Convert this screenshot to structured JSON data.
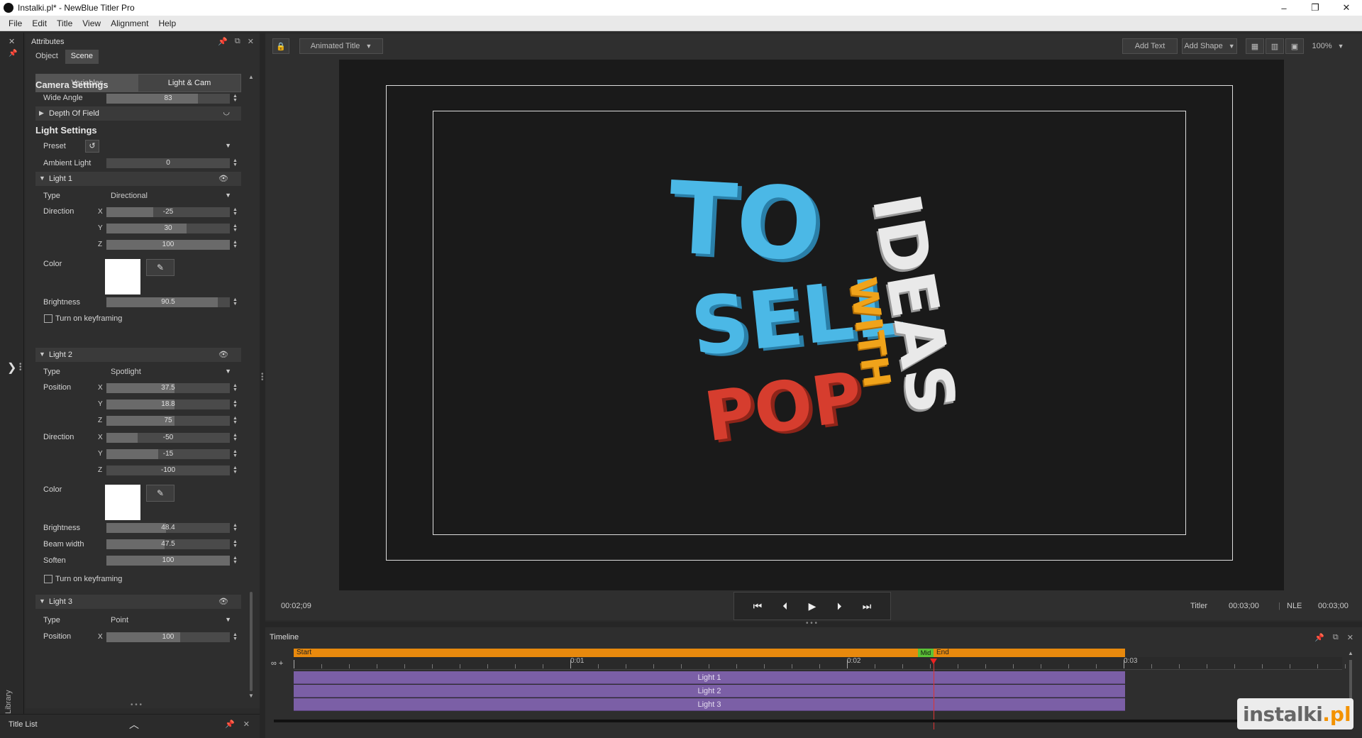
{
  "window": {
    "title": "Instalki.pl* - NewBlue Titler Pro",
    "minimize": "–",
    "maximize": "❐",
    "close": "✕"
  },
  "menu": [
    "File",
    "Edit",
    "Title",
    "View",
    "Alignment",
    "Help"
  ],
  "left_strip": {
    "library_label": "Library"
  },
  "attributes": {
    "title": "Attributes",
    "tabs": [
      {
        "label": "Object",
        "active": false
      },
      {
        "label": "Scene",
        "active": true
      }
    ],
    "subtabs": [
      {
        "label": "Variables",
        "active": false
      },
      {
        "label": "Light & Cam",
        "active": true
      }
    ],
    "camera_settings": {
      "title": "Camera Settings",
      "wide_angle": {
        "label": "Wide Angle",
        "value": "83",
        "fraction": 0.74
      },
      "depth_of_field": {
        "label": "Depth Of Field"
      }
    },
    "light_settings": {
      "title": "Light Settings",
      "preset": {
        "label": "Preset",
        "value": ""
      },
      "ambient_light": {
        "label": "Ambient Light",
        "value": "0",
        "fraction": 0.0
      }
    },
    "light1": {
      "name": "Light 1",
      "type_label": "Type",
      "type_value": "Directional",
      "direction_label": "Direction",
      "x": {
        "axis": "X",
        "value": "-25",
        "fraction": 0.38
      },
      "y": {
        "axis": "Y",
        "value": "30",
        "fraction": 0.65
      },
      "z": {
        "axis": "Z",
        "value": "100",
        "fraction": 1.0
      },
      "color_label": "Color",
      "color": "#ffffff",
      "brightness": {
        "label": "Brightness",
        "value": "90.5",
        "fraction": 0.9
      },
      "keyframing": {
        "label": "Turn on keyframing",
        "checked": false
      }
    },
    "light2": {
      "name": "Light 2",
      "type_label": "Type",
      "type_value": "Spotlight",
      "position_label": "Position",
      "px": {
        "axis": "X",
        "value": "37.5",
        "fraction": 0.55
      },
      "py": {
        "axis": "Y",
        "value": "18.8",
        "fraction": 0.55
      },
      "pz": {
        "axis": "Z",
        "value": "75",
        "fraction": 0.55
      },
      "direction_label": "Direction",
      "dx": {
        "axis": "X",
        "value": "-50",
        "fraction": 0.25
      },
      "dy": {
        "axis": "Y",
        "value": "-15",
        "fraction": 0.42
      },
      "dz": {
        "axis": "Z",
        "value": "-100",
        "fraction": 0.0
      },
      "color_label": "Color",
      "color": "#ffffff",
      "brightness": {
        "label": "Brightness",
        "value": "48.4",
        "fraction": 0.48
      },
      "beam_width": {
        "label": "Beam width",
        "value": "47.5",
        "fraction": 0.47
      },
      "soften": {
        "label": "Soften",
        "value": "100",
        "fraction": 1.0
      },
      "keyframing": {
        "label": "Turn on keyframing",
        "checked": false
      }
    },
    "light3": {
      "name": "Light 3",
      "type_label": "Type",
      "type_value": "Point",
      "position_label": "Position",
      "px": {
        "axis": "X",
        "value": "100",
        "fraction": 0.6
      }
    }
  },
  "title_list": {
    "label": "Title List"
  },
  "canvas_toolbar": {
    "title_type": "Animated Title",
    "add_text": "Add Text",
    "add_shape": "Add Shape",
    "zoom": "100%"
  },
  "artwork": {
    "words": [
      "TO",
      "SELL",
      "POP",
      "IDEAS",
      "WITH"
    ],
    "colors": {
      "blue": "#4bb8e6",
      "white": "#e9e9e9",
      "orange": "#f0a31a",
      "red": "#d63d2e"
    }
  },
  "transport": {
    "current_time": "00:02;09",
    "titler_label": "Titler",
    "titler_time": "00:03;00",
    "nle_label": "NLE",
    "nle_time": "00:03;00"
  },
  "timeline": {
    "title": "Timeline",
    "start_label": "Start",
    "mid_label": "Mid",
    "end_label": "End",
    "ticks": [
      "0:01",
      "0:02",
      "0:03"
    ],
    "tracks": [
      "Light 1",
      "Light 2",
      "Light 3"
    ],
    "colors": {
      "orange": "#e8890d",
      "track": "#7b5fa6",
      "mid": "#5bc236",
      "playhead": "#dd3333"
    }
  },
  "watermark": {
    "part1": "instalki",
    "part2": ".pl"
  }
}
